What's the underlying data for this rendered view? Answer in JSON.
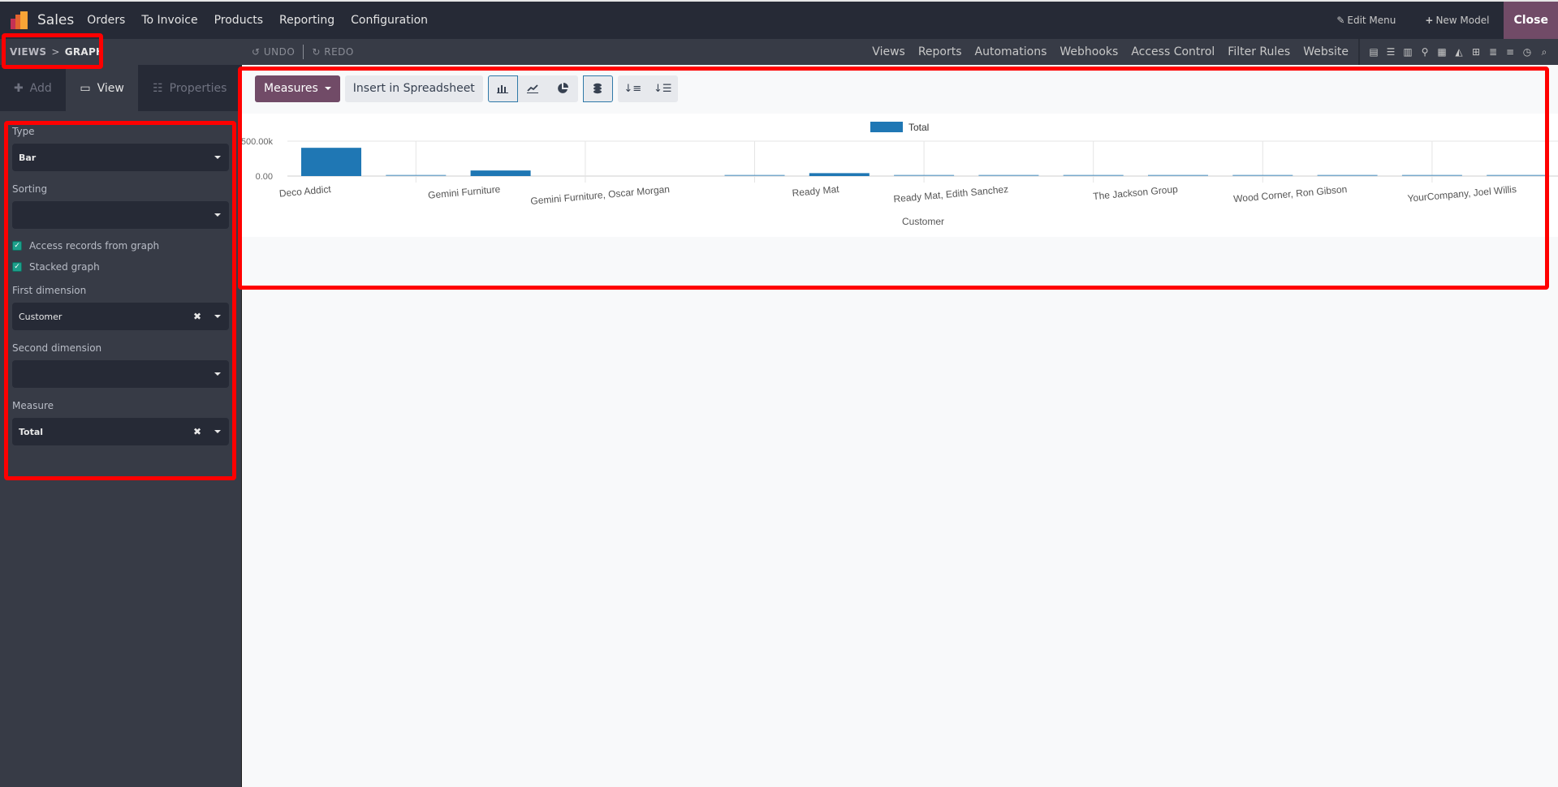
{
  "topbar": {
    "app_name": "Sales",
    "menu": [
      "Orders",
      "To Invoice",
      "Products",
      "Reporting",
      "Configuration"
    ],
    "edit_menu": "Edit Menu",
    "new_model": "New Model",
    "close": "Close"
  },
  "subbar": {
    "breadcrumb": [
      "VIEWS",
      "GRAPH"
    ],
    "breadcrumb_sep": ">",
    "undo": "UNDO",
    "redo": "REDO",
    "studio_nav": [
      "Views",
      "Reports",
      "Automations",
      "Webhooks",
      "Access Control",
      "Filter Rules",
      "Website"
    ],
    "view_icons": [
      "form-view",
      "list-view",
      "kanban-view",
      "map-view",
      "calendar-view",
      "graph-view",
      "pivot-view",
      "gantt-view",
      "cohort-view",
      "activity-view",
      "search-view"
    ]
  },
  "sidebar": {
    "tabs": [
      {
        "label": "Add",
        "icon": "plus-icon",
        "active": false
      },
      {
        "label": "View",
        "icon": "monitor-icon",
        "active": true
      },
      {
        "label": "Properties",
        "icon": "properties-icon",
        "active": false
      }
    ],
    "type": {
      "label": "Type",
      "value": "Bar"
    },
    "sorting": {
      "label": "Sorting",
      "value": ""
    },
    "access_records": {
      "label": "Access records from graph",
      "checked": true
    },
    "stacked": {
      "label": "Stacked graph",
      "checked": true
    },
    "first_dimension": {
      "label": "First dimension",
      "value": "Customer"
    },
    "second_dimension": {
      "label": "Second dimension",
      "value": ""
    },
    "measure": {
      "label": "Measure",
      "value": "Total"
    }
  },
  "toolbar": {
    "measures": "Measures",
    "insert_spreadsheet": "Insert in Spreadsheet",
    "chart_types": [
      {
        "name": "bar-chart",
        "active": true
      },
      {
        "name": "line-chart",
        "active": false
      },
      {
        "name": "pie-chart",
        "active": false
      }
    ],
    "stacked_active": true,
    "sort_descending": "sort-descending",
    "sort_ascending": "sort-ascending"
  },
  "colors": {
    "brand": "#714b67",
    "bar": "#1f77b4",
    "highlight": "#ff0000"
  },
  "chart_data": {
    "type": "bar",
    "title": "",
    "legend": [
      "Total"
    ],
    "legend_position": "top",
    "xlabel": "Customer",
    "ylabel": "",
    "ylim": [
      0,
      500000
    ],
    "yticks": [
      "0.00",
      "500.00k"
    ],
    "grid": true,
    "categories": [
      "Deco Addict",
      null,
      "Gemini Furniture",
      null,
      "Gemini Furniture, Oscar Morgan",
      null,
      "Ready Mat",
      null,
      "Ready Mat, Edith Sanchez",
      null,
      "The Jackson Group",
      null,
      "Wood Corner, Ron Gibson",
      null,
      "YourCompany, Joel Willis"
    ],
    "series": [
      {
        "name": "Total",
        "values": [
          405000,
          3000,
          80000,
          0,
          0,
          3000,
          42000,
          3000,
          3000,
          3000,
          3000,
          3000,
          3000,
          3000,
          3000
        ]
      }
    ]
  }
}
